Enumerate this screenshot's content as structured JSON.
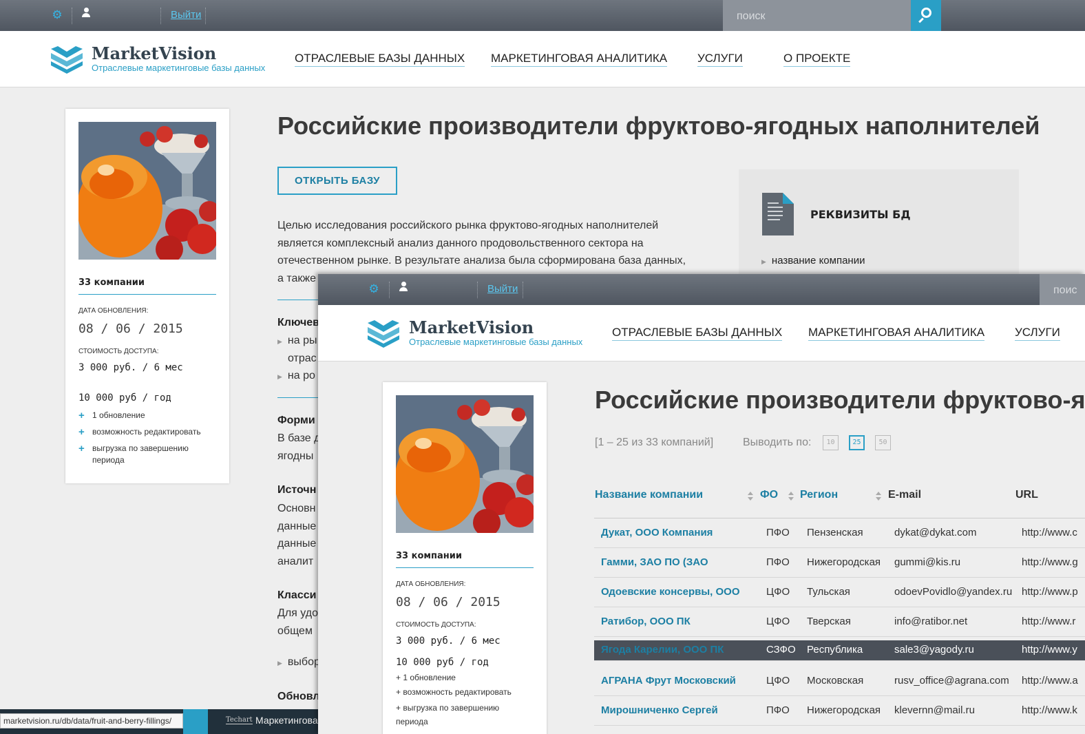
{
  "topbar": {
    "logout_label": "Выйти",
    "search_placeholder": "поиск",
    "front_search_placeholder": "поис"
  },
  "brand": {
    "name": "MarketVision",
    "tagline": "Отраслевые маркетинговые базы данных"
  },
  "nav": [
    "ОТРАСЛЕВЫЕ БАЗЫ ДАННЫХ",
    "МАРКЕТИНГОВАЯ АНАЛИТИКА",
    "УСЛУГИ",
    "О ПРОЕКТЕ"
  ],
  "card": {
    "count": "33 компании",
    "updated_label": "ДАТА ОБНОВЛЕНИЯ:",
    "updated_value": "08 / 06 / 2015",
    "price_label": "СТОИМОСТЬ ДОСТУПА:",
    "price_6m": "3 000 руб. / 6 мес",
    "price_year": "10 000 руб / год",
    "features": [
      "1 обновление",
      "возможность редактировать",
      "выгрузка по завершению периода"
    ]
  },
  "page": {
    "title": "Российские производители фруктово-ягодных наполнителей",
    "front_title": "Российские производители фруктово-ягод",
    "open_button": "ОТКРЫТЬ БАЗУ",
    "intro_lines": [
      "Целью исследования российского рынка фруктово-ягодных наполнителей",
      "является комплексный анализ данного продовольственного сектора на",
      "отечественном рынке. В результате анализа была сформирована база данных,",
      "а также"
    ],
    "section_key_heading": "Ключев",
    "section_key_items": [
      "на ры",
      "отрас",
      "на ро"
    ],
    "section_form_heading": "Форми",
    "section_form_lines": [
      "В базе д",
      "ягодны"
    ],
    "section_source_heading": "Источн",
    "section_source_lines": [
      "Основн",
      "данные",
      "данные",
      "аналит"
    ],
    "section_class_heading": "Класси",
    "section_class_lines": [
      "Для удо",
      "общем"
    ],
    "section_class_item": "выбор",
    "section_update_heading": "Обновл"
  },
  "requisites": {
    "title": "РЕКВИЗИТЫ БД",
    "item": "название компании"
  },
  "table": {
    "range_text": "[1 – 25 из 33 компаний]",
    "per_page_label": "Выводить по:",
    "per_page_options": [
      "10",
      "25",
      "50"
    ],
    "per_page_selected": "25",
    "headers": [
      "Название компании",
      "ФО",
      "Регион",
      "E-mail",
      "URL"
    ],
    "rows": [
      {
        "name": "Дукат, ООО Компания",
        "fo": "ПФО",
        "region": "Пензенская",
        "email": "dykat@dykat.com",
        "url": "http://www.c"
      },
      {
        "name": "Гамми, ЗАО ПО (ЗАО",
        "fo": "ПФО",
        "region": "Нижегородская",
        "email": "gummi@kis.ru",
        "url": "http://www.g"
      },
      {
        "name": "Одоевские консервы, ООО",
        "fo": "ЦФО",
        "region": "Тульская",
        "email": "odoevPovidlo@yandex.ru",
        "url": "http://www.p"
      },
      {
        "name": "Ратибор, ООО ПК",
        "fo": "ЦФО",
        "region": "Тверская",
        "email": "info@ratibor.net",
        "url": "http://www.r"
      },
      {
        "name": "Ягода Карелии, ООО ПК",
        "fo": "СЗФО",
        "region": "Республика",
        "email": "sale3@yagody.ru",
        "url": "http://www.y"
      },
      {
        "name": "АГРАНА Фрут Московский",
        "fo": "ЦФО",
        "region": "Московская",
        "email": "rusv_office@agrana.com",
        "url": "http://www.a"
      },
      {
        "name": "Мирошниченко Сергей",
        "fo": "ПФО",
        "region": "Нижегородская",
        "email": "klevernn@mail.ru",
        "url": "http://www.k"
      }
    ]
  },
  "status": {
    "url": "marketvision.ru/db/data/fruit-and-berry-fillings/",
    "taskbar_logo": "Techart",
    "taskbar_title": "Маркетингова"
  },
  "colors": {
    "accent": "#2a9fc6",
    "topbar": "#5b626b",
    "highlight_row": "#4a5059"
  }
}
